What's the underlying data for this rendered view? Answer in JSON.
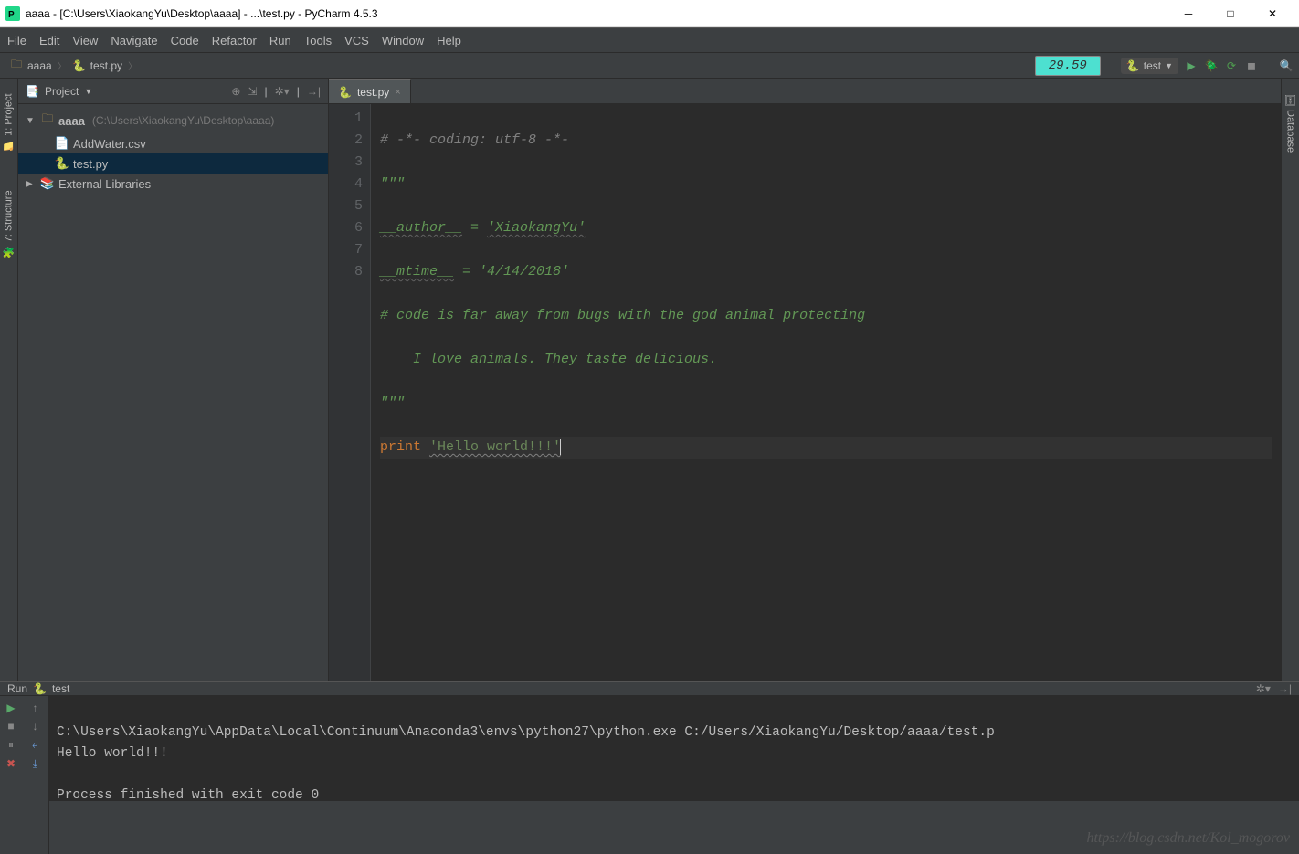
{
  "window": {
    "title": "aaaa - [C:\\Users\\XiaokangYu\\Desktop\\aaaa] - ...\\test.py - PyCharm 4.5.3"
  },
  "menu": {
    "file": "File",
    "edit": "Edit",
    "view": "View",
    "navigate": "Navigate",
    "code": "Code",
    "refactor": "Refactor",
    "run": "Run",
    "tools": "Tools",
    "vcs": "VCS",
    "window": "Window",
    "help": "Help"
  },
  "breadcrumb": {
    "root": "aaaa",
    "file": "test.py"
  },
  "timer": "29.59",
  "runconfig": {
    "label": "test"
  },
  "project": {
    "pane": "Project",
    "root": "aaaa",
    "root_hint": "(C:\\Users\\XiaokangYu\\Desktop\\aaaa)",
    "files": [
      "AddWater.csv",
      "test.py"
    ],
    "ext": "External Libraries"
  },
  "editor": {
    "tab": "test.py",
    "lines": [
      "1",
      "2",
      "3",
      "4",
      "5",
      "6",
      "7",
      "8"
    ],
    "code": {
      "l1": "# -*- coding: utf-8 -*-",
      "l2": "\"\"\"",
      "l3a": "__author__",
      "l3b": " = ",
      "l3c": "'XiaokangYu'",
      "l4a": "__mtime__",
      "l4b": " = ",
      "l4c": "'4/14/2018'",
      "l5": "# code is far away from bugs with the god animal protecting",
      "l6": "    I love animals. They taste delicious.",
      "l7": "\"\"\"",
      "l8a": "print",
      "l8b": " ",
      "l8c": "'Hello world!!!'"
    }
  },
  "run": {
    "title": "Run",
    "target": "test",
    "console_line1": "C:\\Users\\XiaokangYu\\AppData\\Local\\Continuum\\Anaconda3\\envs\\python27\\python.exe C:/Users/XiaokangYu/Desktop/aaaa/test.p",
    "console_line2": "Hello world!!!",
    "console_line3": "",
    "console_line4": "Process finished with exit code 0"
  },
  "sidetabs": {
    "project": "1: Project",
    "structure": "7: Structure",
    "database": "Database"
  },
  "watermark": "https://blog.csdn.net/Kol_mogorov"
}
